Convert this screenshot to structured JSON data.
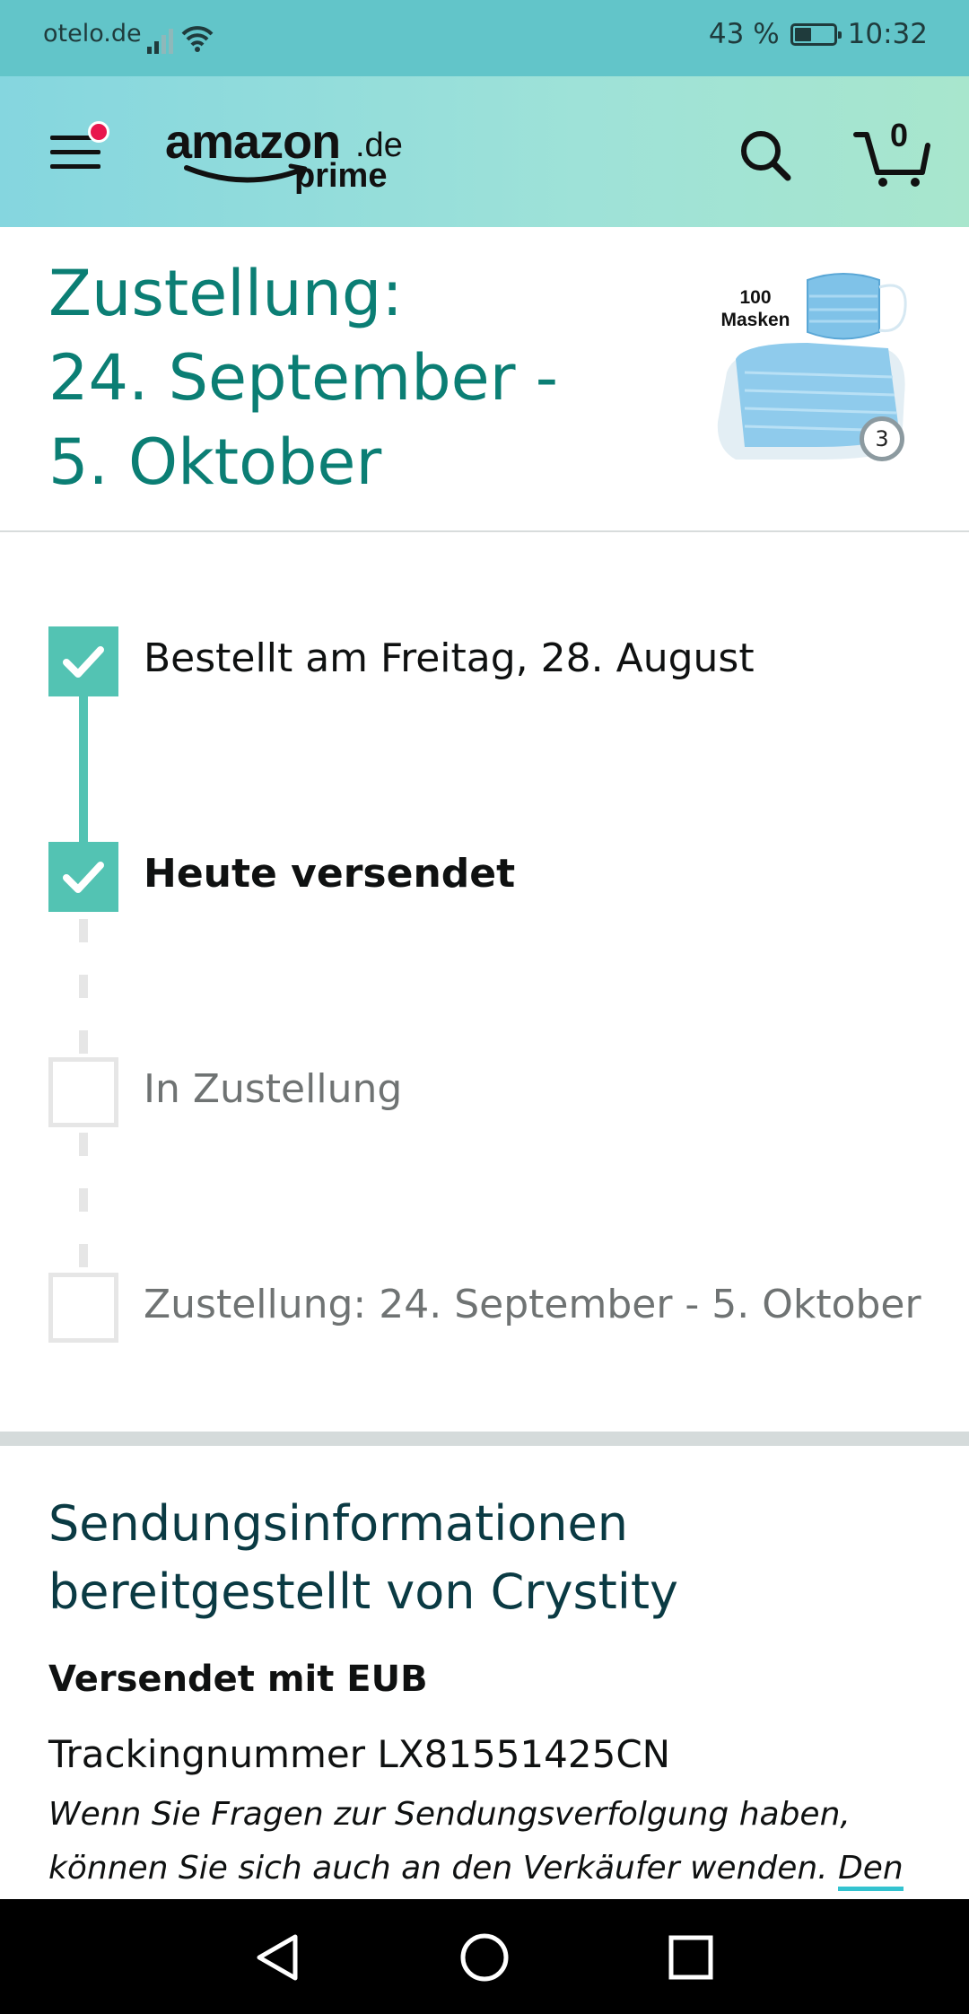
{
  "status_bar": {
    "carrier": "otelo.de",
    "battery": "43 %",
    "time": "10:32",
    "icons": [
      "signal-icon",
      "wifi-icon",
      "battery-icon"
    ]
  },
  "header": {
    "logo_word": "amazon",
    "logo_tld": ".de",
    "logo_sub": "prime",
    "cart_count": "0",
    "icons": [
      "menu-icon",
      "search-icon",
      "cart-icon"
    ],
    "notification_color": "#e8164d"
  },
  "delivery": {
    "title_lines": [
      "Zustellung:",
      "24. September -",
      "5. Oktober"
    ],
    "product_label_lines": [
      "100",
      "Masken"
    ],
    "quantity": "3"
  },
  "tracker": {
    "steps": [
      {
        "label": "Bestellt am Freitag, 28. August",
        "state": "done"
      },
      {
        "label": "Heute versendet",
        "state": "current"
      },
      {
        "label": "In Zustellung",
        "state": "todo"
      },
      {
        "label": "Zustellung: 24. September - 5. Oktober",
        "state": "todo"
      }
    ],
    "accent_color": "#53c3b3"
  },
  "shipment_info": {
    "title": "Sendungsinformationen bereitgestellt von Crystity",
    "carrier": "Versendet mit EUB",
    "tracking": "Trackingnummer LX81551425CN",
    "note": "Wenn Sie Fragen zur Sendungsverfolgung haben, können Sie sich auch an den Verkäufer wenden.",
    "link": "Den"
  },
  "nav": {
    "icons": [
      "back-icon",
      "home-icon",
      "recents-icon"
    ]
  },
  "colors": {
    "status_bar": "#62c5c9",
    "title_teal": "#0b7e74",
    "info_title": "#0a3a43"
  }
}
